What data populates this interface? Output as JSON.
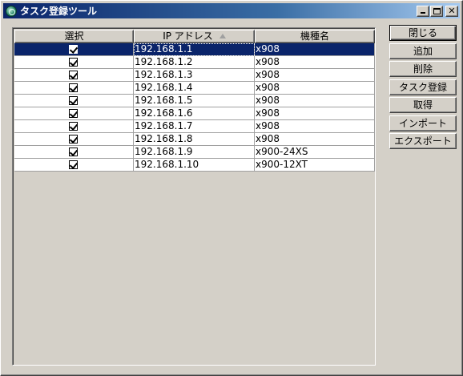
{
  "window": {
    "title": "タスク登録ツール",
    "icon": "app-globe-icon"
  },
  "columns": {
    "select": "選択",
    "ip": "IP アドレス",
    "model": "機種名",
    "sorted_column": "ip"
  },
  "rows": [
    {
      "checked": true,
      "ip": "192.168.1.1",
      "model": "x908",
      "selected": true
    },
    {
      "checked": true,
      "ip": "192.168.1.2",
      "model": "x908"
    },
    {
      "checked": true,
      "ip": "192.168.1.3",
      "model": "x908"
    },
    {
      "checked": true,
      "ip": "192.168.1.4",
      "model": "x908"
    },
    {
      "checked": true,
      "ip": "192.168.1.5",
      "model": "x908"
    },
    {
      "checked": true,
      "ip": "192.168.1.6",
      "model": "x908"
    },
    {
      "checked": true,
      "ip": "192.168.1.7",
      "model": "x908"
    },
    {
      "checked": true,
      "ip": "192.168.1.8",
      "model": "x908"
    },
    {
      "checked": true,
      "ip": "192.168.1.9",
      "model": "x900-24XS"
    },
    {
      "checked": true,
      "ip": "192.168.1.10",
      "model": "x900-12XT"
    }
  ],
  "buttons": {
    "close": "閉じる",
    "add": "追加",
    "delete": "削除",
    "register_task": "タスク登録",
    "acquire": "取得",
    "import": "インポート",
    "export": "エクスポート"
  },
  "colors": {
    "titlebar_start": "#0a246a",
    "selection": "#0a246a",
    "face": "#d4d0c8"
  }
}
